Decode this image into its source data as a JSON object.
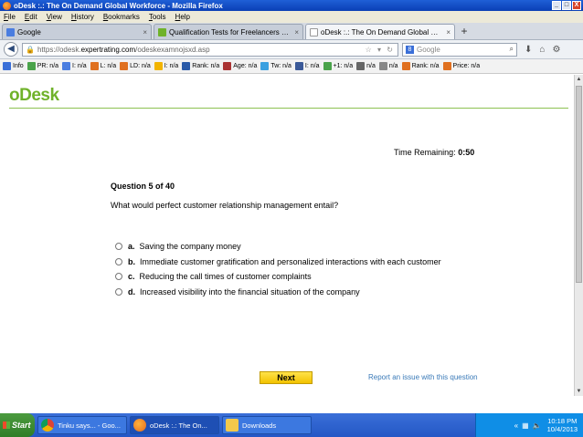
{
  "window": {
    "title": "oDesk :.: The On Demand Global Workforce - Mozilla Firefox",
    "controls": [
      "_",
      "□",
      "X"
    ]
  },
  "menubar": [
    "File",
    "Edit",
    "View",
    "History",
    "Bookmarks",
    "Tools",
    "Help"
  ],
  "tabs": [
    {
      "label": "Google",
      "active": false,
      "color": "#4a7de0"
    },
    {
      "label": "Qualification Tests for Freelancers & Pr...",
      "active": false,
      "color": "#6fb22a"
    },
    {
      "label": "oDesk :.: The On Demand Global Wor...",
      "active": true,
      "color": "#ffffff"
    }
  ],
  "navbar": {
    "url_prefix": "https://odesk.",
    "url_host": "expertrating.com",
    "url_path": "/odeskexamnojsxd.asp",
    "search_placeholder": "Google"
  },
  "seobar": [
    {
      "label": "Info",
      "color": "#3a6fd8"
    },
    {
      "label": "PR: n/a",
      "color": "#4aa34a"
    },
    {
      "label": "I: n/a",
      "color": "#4a7de0"
    },
    {
      "label": "L: n/a",
      "color": "#e0701f"
    },
    {
      "label": "LD: n/a",
      "color": "#e0701f"
    },
    {
      "label": "I: n/a",
      "color": "#f2b400"
    },
    {
      "label": "Rank: n/a",
      "color": "#2a5aa8"
    },
    {
      "label": "Age: n/a",
      "color": "#a33"
    },
    {
      "label": "Tw: n/a",
      "color": "#3aa0e0"
    },
    {
      "label": "I: n/a",
      "color": "#3b5998"
    },
    {
      "label": "+1: n/a",
      "color": "#4aa34a"
    },
    {
      "label": "n/a",
      "color": "#666"
    },
    {
      "label": "n/a",
      "color": "#888"
    },
    {
      "label": "Rank: n/a",
      "color": "#e0701f"
    },
    {
      "label": "Price: n/a",
      "color": "#e0701f"
    }
  ],
  "page": {
    "logo": "oDesk",
    "timer_label": "Time Remaining:",
    "timer_value": "0:50",
    "question_number": "Question 5 of 40",
    "question_text": "What would perfect customer relationship management entail?",
    "options": [
      {
        "letter": "a.",
        "text": "Saving the company money"
      },
      {
        "letter": "b.",
        "text": "Immediate customer gratification and personalized interactions with each customer"
      },
      {
        "letter": "c.",
        "text": "Reducing the call times of customer complaints"
      },
      {
        "letter": "d.",
        "text": "Increased visibility into the financial situation of the company"
      }
    ],
    "next_label": "Next",
    "report_label": "Report an issue with this question"
  },
  "taskbar": {
    "start_label": "Start",
    "tasks": [
      {
        "label": "Tinku says... - Goo...",
        "color": "#e8b400",
        "active": false
      },
      {
        "label": "oDesk :.: The On...",
        "color": "#e2691d",
        "active": true
      },
      {
        "label": "Downloads",
        "color": "#f2c94c",
        "active": false
      }
    ],
    "clock_time": "10:18 PM",
    "clock_date": "10/4/2013"
  }
}
